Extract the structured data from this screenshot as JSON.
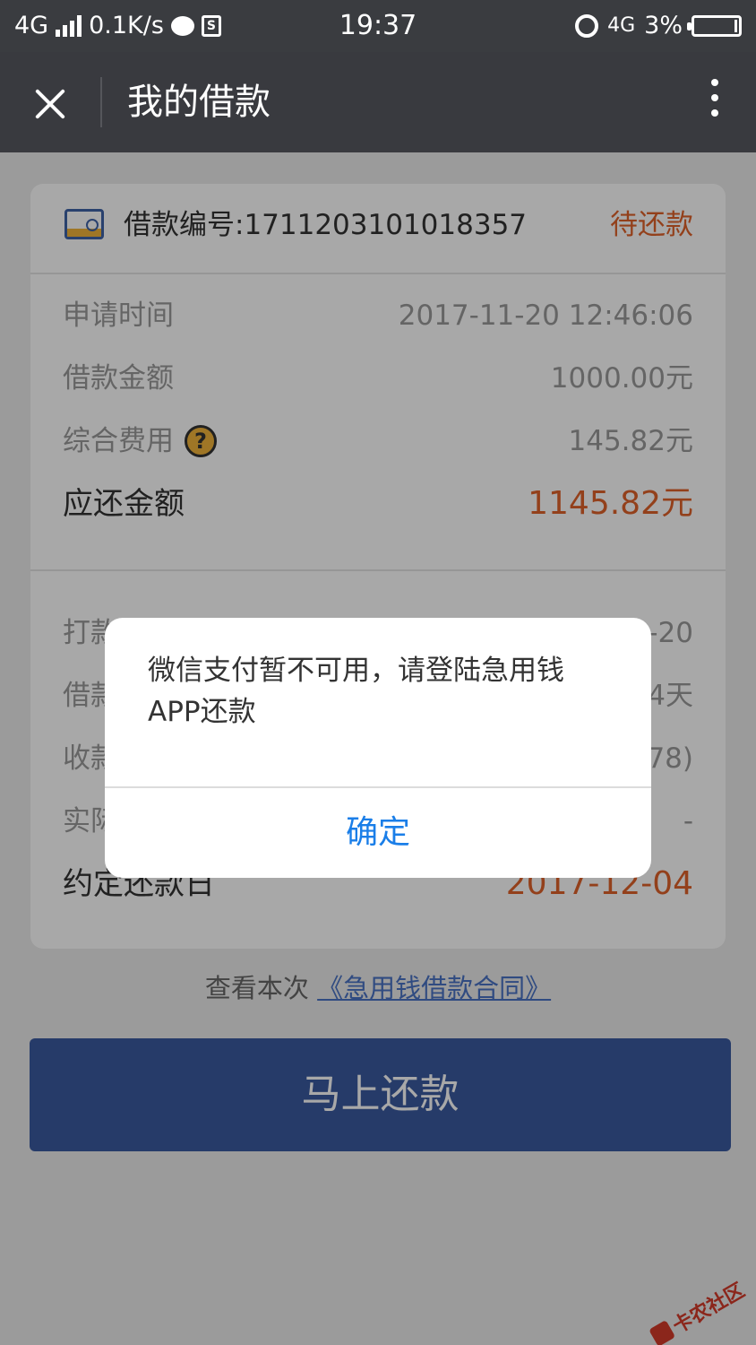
{
  "status_bar": {
    "network": "4G",
    "speed": "0.1K/s",
    "time": "19:37",
    "network_right": "4G",
    "battery": "3%"
  },
  "titlebar": {
    "title": "我的借款"
  },
  "loan": {
    "number_label": "借款编号:1711203101018357",
    "status": "待还款",
    "rows": [
      {
        "label": "申请时间",
        "value": "2017-11-20 12:46:06"
      },
      {
        "label": "借款金额",
        "value": "1000.00元"
      },
      {
        "label": "综合费用",
        "value": "145.82元"
      },
      {
        "label": "应还金额",
        "value": "1145.82元"
      }
    ],
    "rows2": [
      {
        "label": "打款",
        "value": "-20"
      },
      {
        "label": "借款",
        "value": "4天"
      },
      {
        "label": "收款",
        "value": "78)"
      },
      {
        "label": "实际",
        "value": "-"
      },
      {
        "label": "约定还款日",
        "value": "2017-12-04"
      }
    ]
  },
  "contract": {
    "prefix": "查看本次",
    "link": "《急用钱借款合同》"
  },
  "repay_button": "马上还款",
  "dialog": {
    "message": "微信支付暂不可用，请登陆急用钱APP还款",
    "ok": "确定"
  },
  "watermark": "卡农社区",
  "colors": {
    "accent_orange": "#e0622a",
    "primary_blue": "#3b5aa0",
    "link_blue": "#1a7ee8"
  }
}
